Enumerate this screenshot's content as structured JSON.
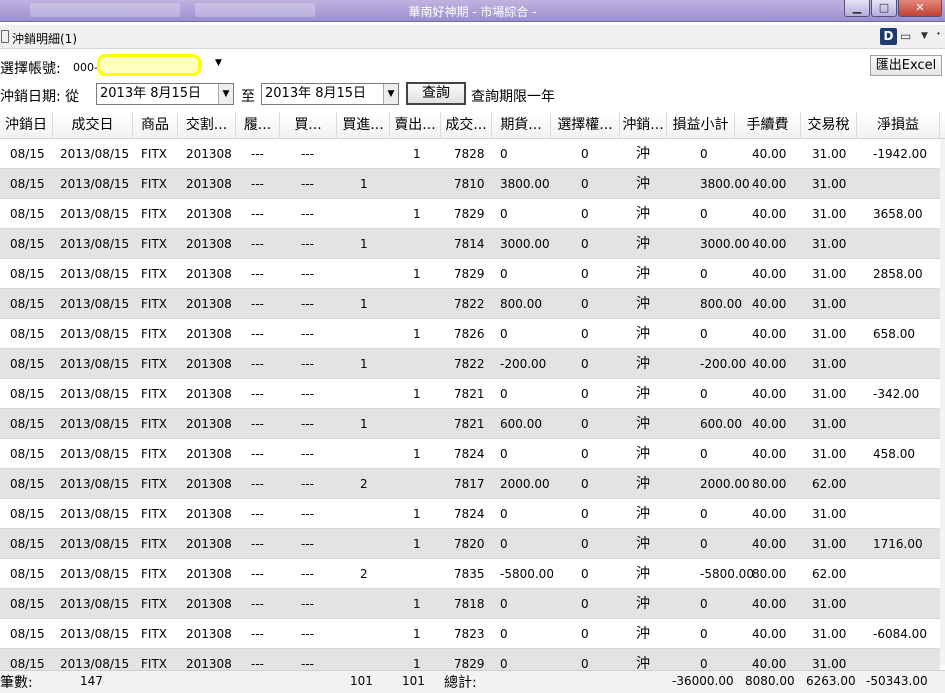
{
  "window": {
    "title": "華南好神期 - 市場綜合 -",
    "controls": [
      "minimize",
      "maximize",
      "close"
    ]
  },
  "panel": {
    "title": "沖銷明細(1)",
    "icons": [
      "d-icon",
      "page-icon",
      "dropdown-icon",
      "pin-icon"
    ]
  },
  "account": {
    "label": "選擇帳號:",
    "prefix": "000-"
  },
  "export_label": "匯出Excel",
  "date_filter": {
    "label": "沖銷日期: 從",
    "from": "2013年  8月15日",
    "to_label": "至",
    "to": "2013年  8月15日",
    "query_label": "查詢",
    "note": "查詢期限一年"
  },
  "columns": [
    "沖銷日",
    "成交日",
    "商品",
    "交割...",
    "履...",
    "買...",
    "買進...",
    "賣出...",
    "成交...",
    "期貨...",
    "選擇權...",
    "沖銷...",
    "損益小計",
    "手續費",
    "交易稅",
    "淨損益"
  ],
  "rows": [
    [
      "08/15",
      "2013/08/15",
      "FITX",
      "201308",
      "---",
      "---",
      "",
      "1",
      "7828",
      "0",
      "0",
      "沖",
      "0",
      "40.00",
      "31.00",
      "-1942.00"
    ],
    [
      "08/15",
      "2013/08/15",
      "FITX",
      "201308",
      "---",
      "---",
      "1",
      "",
      "7810",
      "3800.00",
      "0",
      "沖",
      "3800.00",
      "40.00",
      "31.00",
      ""
    ],
    [
      "08/15",
      "2013/08/15",
      "FITX",
      "201308",
      "---",
      "---",
      "",
      "1",
      "7829",
      "0",
      "0",
      "沖",
      "0",
      "40.00",
      "31.00",
      "3658.00"
    ],
    [
      "08/15",
      "2013/08/15",
      "FITX",
      "201308",
      "---",
      "---",
      "1",
      "",
      "7814",
      "3000.00",
      "0",
      "沖",
      "3000.00",
      "40.00",
      "31.00",
      ""
    ],
    [
      "08/15",
      "2013/08/15",
      "FITX",
      "201308",
      "---",
      "---",
      "",
      "1",
      "7829",
      "0",
      "0",
      "沖",
      "0",
      "40.00",
      "31.00",
      "2858.00"
    ],
    [
      "08/15",
      "2013/08/15",
      "FITX",
      "201308",
      "---",
      "---",
      "1",
      "",
      "7822",
      "800.00",
      "0",
      "沖",
      "800.00",
      "40.00",
      "31.00",
      ""
    ],
    [
      "08/15",
      "2013/08/15",
      "FITX",
      "201308",
      "---",
      "---",
      "",
      "1",
      "7826",
      "0",
      "0",
      "沖",
      "0",
      "40.00",
      "31.00",
      "658.00"
    ],
    [
      "08/15",
      "2013/08/15",
      "FITX",
      "201308",
      "---",
      "---",
      "1",
      "",
      "7822",
      "-200.00",
      "0",
      "沖",
      "-200.00",
      "40.00",
      "31.00",
      ""
    ],
    [
      "08/15",
      "2013/08/15",
      "FITX",
      "201308",
      "---",
      "---",
      "",
      "1",
      "7821",
      "0",
      "0",
      "沖",
      "0",
      "40.00",
      "31.00",
      "-342.00"
    ],
    [
      "08/15",
      "2013/08/15",
      "FITX",
      "201308",
      "---",
      "---",
      "1",
      "",
      "7821",
      "600.00",
      "0",
      "沖",
      "600.00",
      "40.00",
      "31.00",
      ""
    ],
    [
      "08/15",
      "2013/08/15",
      "FITX",
      "201308",
      "---",
      "---",
      "",
      "1",
      "7824",
      "0",
      "0",
      "沖",
      "0",
      "40.00",
      "31.00",
      "458.00"
    ],
    [
      "08/15",
      "2013/08/15",
      "FITX",
      "201308",
      "---",
      "---",
      "2",
      "",
      "7817",
      "2000.00",
      "0",
      "沖",
      "2000.00",
      "80.00",
      "62.00",
      ""
    ],
    [
      "08/15",
      "2013/08/15",
      "FITX",
      "201308",
      "---",
      "---",
      "",
      "1",
      "7824",
      "0",
      "0",
      "沖",
      "0",
      "40.00",
      "31.00",
      ""
    ],
    [
      "08/15",
      "2013/08/15",
      "FITX",
      "201308",
      "---",
      "---",
      "",
      "1",
      "7820",
      "0",
      "0",
      "沖",
      "0",
      "40.00",
      "31.00",
      "1716.00"
    ],
    [
      "08/15",
      "2013/08/15",
      "FITX",
      "201308",
      "---",
      "---",
      "2",
      "",
      "7835",
      "-5800.00",
      "0",
      "沖",
      "-5800.00",
      "80.00",
      "62.00",
      ""
    ],
    [
      "08/15",
      "2013/08/15",
      "FITX",
      "201308",
      "---",
      "---",
      "",
      "1",
      "7818",
      "0",
      "0",
      "沖",
      "0",
      "40.00",
      "31.00",
      ""
    ],
    [
      "08/15",
      "2013/08/15",
      "FITX",
      "201308",
      "---",
      "---",
      "",
      "1",
      "7823",
      "0",
      "0",
      "沖",
      "0",
      "40.00",
      "31.00",
      "-6084.00"
    ],
    [
      "08/15",
      "2013/08/15",
      "FITX",
      "201308",
      "---",
      "---",
      "",
      "1",
      "7829",
      "0",
      "0",
      "沖",
      "0",
      "40.00",
      "31.00",
      ""
    ]
  ],
  "footer": {
    "count_label": "筆數:",
    "count": "147",
    "buy_total": "101",
    "sell_total": "101",
    "total_label": "總計:",
    "pnl_subtotal": "-36000.00",
    "fee_total": "8080.00",
    "tax_total": "6263.00",
    "net_total": "-50343.00"
  }
}
